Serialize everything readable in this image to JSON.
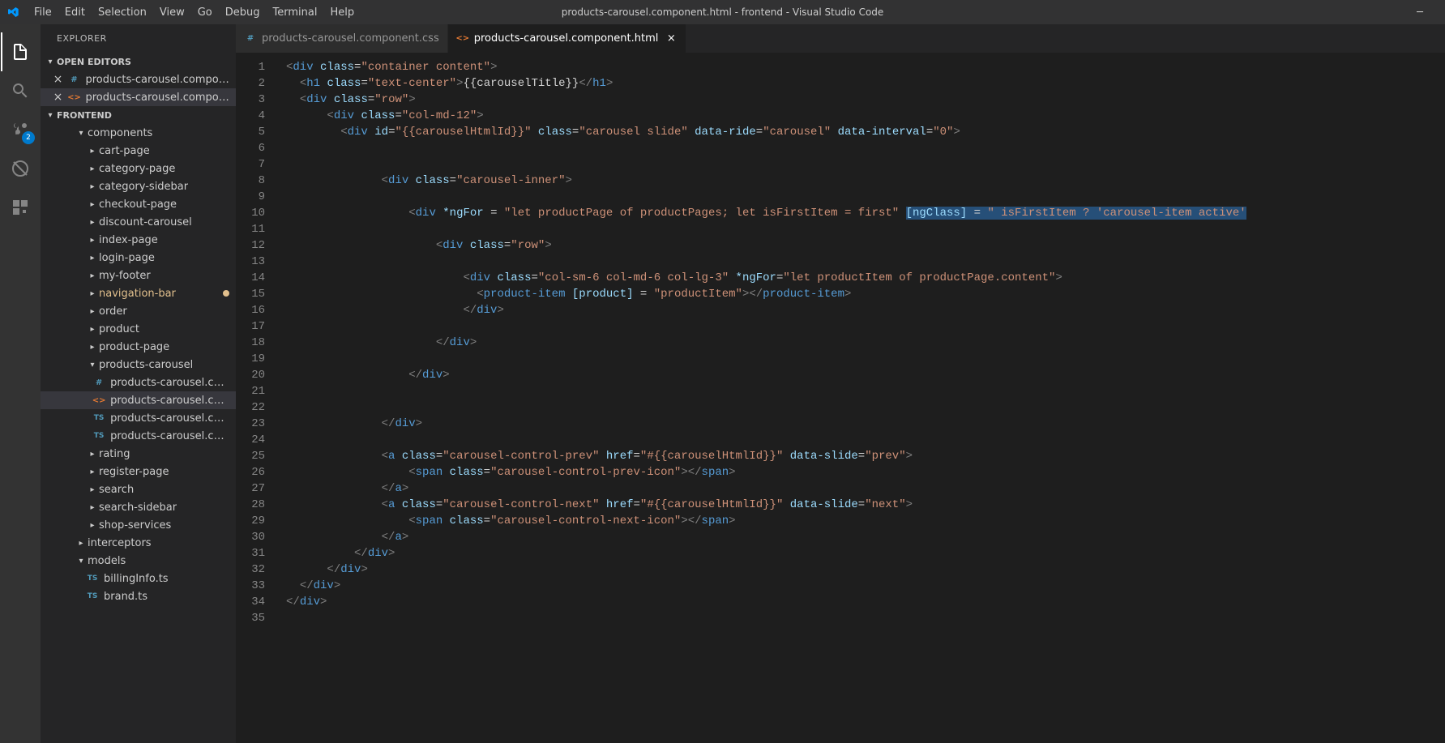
{
  "window": {
    "title": "products-carousel.component.html - frontend - Visual Studio Code"
  },
  "menu": [
    "File",
    "Edit",
    "Selection",
    "View",
    "Go",
    "Debug",
    "Terminal",
    "Help"
  ],
  "activity": {
    "badge_scm": "2"
  },
  "sidebar": {
    "title": "EXPLORER",
    "sections": {
      "openEditors": "OPEN EDITORS",
      "project": "FRONTEND"
    },
    "openEditors": [
      {
        "label": "products-carousel.compon...",
        "icon": "css"
      },
      {
        "label": "products-carousel.compon...",
        "icon": "html"
      }
    ],
    "tree": [
      {
        "d": 3,
        "type": "folder-open",
        "label": "components"
      },
      {
        "d": 4,
        "type": "folder",
        "label": "cart-page"
      },
      {
        "d": 4,
        "type": "folder",
        "label": "category-page"
      },
      {
        "d": 4,
        "type": "folder",
        "label": "category-sidebar"
      },
      {
        "d": 4,
        "type": "folder",
        "label": "checkout-page"
      },
      {
        "d": 4,
        "type": "folder",
        "label": "discount-carousel"
      },
      {
        "d": 4,
        "type": "folder",
        "label": "index-page"
      },
      {
        "d": 4,
        "type": "folder",
        "label": "login-page"
      },
      {
        "d": 4,
        "type": "folder",
        "label": "my-footer"
      },
      {
        "d": 4,
        "type": "folder",
        "label": "navigation-bar",
        "modified": true
      },
      {
        "d": 4,
        "type": "folder",
        "label": "order"
      },
      {
        "d": 4,
        "type": "folder",
        "label": "product"
      },
      {
        "d": 4,
        "type": "folder",
        "label": "product-page"
      },
      {
        "d": 4,
        "type": "folder-open",
        "label": "products-carousel"
      },
      {
        "d": 5,
        "type": "file",
        "icon": "css",
        "label": "products-carousel.com..."
      },
      {
        "d": 5,
        "type": "file",
        "icon": "html",
        "label": "products-carousel.com...",
        "active": true
      },
      {
        "d": 5,
        "type": "file",
        "icon": "ts",
        "label": "products-carousel.com..."
      },
      {
        "d": 5,
        "type": "file",
        "icon": "ts",
        "label": "products-carousel.com..."
      },
      {
        "d": 4,
        "type": "folder",
        "label": "rating"
      },
      {
        "d": 4,
        "type": "folder",
        "label": "register-page"
      },
      {
        "d": 4,
        "type": "folder",
        "label": "search"
      },
      {
        "d": 4,
        "type": "folder",
        "label": "search-sidebar"
      },
      {
        "d": 4,
        "type": "folder",
        "label": "shop-services"
      },
      {
        "d": 3,
        "type": "folder",
        "label": "interceptors"
      },
      {
        "d": 3,
        "type": "folder-open",
        "label": "models"
      },
      {
        "d": 4,
        "type": "file",
        "icon": "ts",
        "label": "billingInfo.ts"
      },
      {
        "d": 4,
        "type": "file",
        "icon": "ts",
        "label": "brand.ts"
      }
    ]
  },
  "tabs": [
    {
      "label": "products-carousel.component.css",
      "icon": "css",
      "active": false
    },
    {
      "label": "products-carousel.component.html",
      "icon": "html",
      "active": true
    }
  ],
  "editor": {
    "lineStart": 1,
    "lineEnd": 35,
    "code": [
      [
        [
          "br",
          "<"
        ],
        [
          "tag",
          "div"
        ],
        [
          "sp",
          " "
        ],
        [
          "attr",
          "class"
        ],
        [
          "eq",
          "="
        ],
        [
          "str",
          "\"container content\""
        ],
        [
          "br",
          ">"
        ]
      ],
      [
        [
          "sp",
          "  "
        ],
        [
          "br",
          "<"
        ],
        [
          "tag",
          "h1"
        ],
        [
          "sp",
          " "
        ],
        [
          "attr",
          "class"
        ],
        [
          "eq",
          "="
        ],
        [
          "str",
          "\"text-center\""
        ],
        [
          "br",
          ">"
        ],
        [
          "txt",
          "{{carouselTitle}}"
        ],
        [
          "br",
          "</"
        ],
        [
          "tag",
          "h1"
        ],
        [
          "br",
          ">"
        ]
      ],
      [
        [
          "sp",
          "  "
        ],
        [
          "br",
          "<"
        ],
        [
          "tag",
          "div"
        ],
        [
          "sp",
          " "
        ],
        [
          "attr",
          "class"
        ],
        [
          "eq",
          "="
        ],
        [
          "str",
          "\"row\""
        ],
        [
          "br",
          ">"
        ]
      ],
      [
        [
          "sp",
          "      "
        ],
        [
          "br",
          "<"
        ],
        [
          "tag",
          "div"
        ],
        [
          "sp",
          " "
        ],
        [
          "attr",
          "class"
        ],
        [
          "eq",
          "="
        ],
        [
          "str",
          "\"col-md-12\""
        ],
        [
          "br",
          ">"
        ]
      ],
      [
        [
          "sp",
          "        "
        ],
        [
          "br",
          "<"
        ],
        [
          "tag",
          "div"
        ],
        [
          "sp",
          " "
        ],
        [
          "attr",
          "id"
        ],
        [
          "eq",
          "="
        ],
        [
          "str",
          "\"{{carouselHtmlId}}\""
        ],
        [
          "sp",
          " "
        ],
        [
          "attr",
          "class"
        ],
        [
          "eq",
          "="
        ],
        [
          "str",
          "\"carousel slide\""
        ],
        [
          "sp",
          " "
        ],
        [
          "attr",
          "data-ride"
        ],
        [
          "eq",
          "="
        ],
        [
          "str",
          "\"carousel\""
        ],
        [
          "sp",
          " "
        ],
        [
          "attr",
          "data-interval"
        ],
        [
          "eq",
          "="
        ],
        [
          "str",
          "\"0\""
        ],
        [
          "br",
          ">"
        ]
      ],
      [
        [
          "sp",
          ""
        ]
      ],
      [
        [
          "sp",
          ""
        ]
      ],
      [
        [
          "sp",
          "              "
        ],
        [
          "br",
          "<"
        ],
        [
          "tag",
          "div"
        ],
        [
          "sp",
          " "
        ],
        [
          "attr",
          "class"
        ],
        [
          "eq",
          "="
        ],
        [
          "str",
          "\"carousel-inner\""
        ],
        [
          "br",
          ">"
        ]
      ],
      [
        [
          "sp",
          ""
        ]
      ],
      [
        [
          "sp",
          "                  "
        ],
        [
          "br",
          "<"
        ],
        [
          "tag",
          "div"
        ],
        [
          "sp",
          " "
        ],
        [
          "attr",
          "*ngFor"
        ],
        [
          "sp",
          " "
        ],
        [
          "eq",
          "="
        ],
        [
          "sp",
          " "
        ],
        [
          "str",
          "\"let productPage of productPages; let isFirstItem = first\""
        ],
        [
          "sp",
          " "
        ],
        [
          "hl-attr",
          "[ngClass]"
        ],
        [
          "hl-sp",
          " "
        ],
        [
          "hl-eq",
          "="
        ],
        [
          "hl-sp",
          " "
        ],
        [
          "hl-str",
          "\" isFirstItem ? 'carousel-item active'"
        ]
      ],
      [
        [
          "sp",
          ""
        ]
      ],
      [
        [
          "sp",
          "                      "
        ],
        [
          "br",
          "<"
        ],
        [
          "tag",
          "div"
        ],
        [
          "sp",
          " "
        ],
        [
          "attr",
          "class"
        ],
        [
          "eq",
          "="
        ],
        [
          "str",
          "\"row\""
        ],
        [
          "br",
          ">"
        ]
      ],
      [
        [
          "sp",
          ""
        ]
      ],
      [
        [
          "sp",
          "                          "
        ],
        [
          "br",
          "<"
        ],
        [
          "tag",
          "div"
        ],
        [
          "sp",
          " "
        ],
        [
          "attr",
          "class"
        ],
        [
          "eq",
          "="
        ],
        [
          "str",
          "\"col-sm-6 col-md-6 col-lg-3\""
        ],
        [
          "sp",
          " "
        ],
        [
          "attr",
          "*ngFor"
        ],
        [
          "eq",
          "="
        ],
        [
          "str",
          "\"let productItem of productPage.content\""
        ],
        [
          "br",
          ">"
        ]
      ],
      [
        [
          "sp",
          "                            "
        ],
        [
          "br",
          "<"
        ],
        [
          "tag",
          "product-item"
        ],
        [
          "sp",
          " "
        ],
        [
          "attr",
          "[product]"
        ],
        [
          "sp",
          " "
        ],
        [
          "eq",
          "="
        ],
        [
          "sp",
          " "
        ],
        [
          "str",
          "\"productItem\""
        ],
        [
          "br",
          ">"
        ],
        [
          "br",
          "</"
        ],
        [
          "tag",
          "product-item"
        ],
        [
          "br",
          ">"
        ]
      ],
      [
        [
          "sp",
          "                          "
        ],
        [
          "br",
          "</"
        ],
        [
          "tag",
          "div"
        ],
        [
          "br",
          ">"
        ]
      ],
      [
        [
          "sp",
          ""
        ]
      ],
      [
        [
          "sp",
          "                      "
        ],
        [
          "br",
          "</"
        ],
        [
          "tag",
          "div"
        ],
        [
          "br",
          ">"
        ]
      ],
      [
        [
          "sp",
          ""
        ]
      ],
      [
        [
          "sp",
          "                  "
        ],
        [
          "br",
          "</"
        ],
        [
          "tag",
          "div"
        ],
        [
          "br",
          ">"
        ]
      ],
      [
        [
          "sp",
          ""
        ]
      ],
      [
        [
          "sp",
          ""
        ]
      ],
      [
        [
          "sp",
          "              "
        ],
        [
          "br",
          "</"
        ],
        [
          "tag",
          "div"
        ],
        [
          "br",
          ">"
        ]
      ],
      [
        [
          "sp",
          ""
        ]
      ],
      [
        [
          "sp",
          "              "
        ],
        [
          "br",
          "<"
        ],
        [
          "tag",
          "a"
        ],
        [
          "sp",
          " "
        ],
        [
          "attr",
          "class"
        ],
        [
          "eq",
          "="
        ],
        [
          "str",
          "\"carousel-control-prev\""
        ],
        [
          "sp",
          " "
        ],
        [
          "attr",
          "href"
        ],
        [
          "eq",
          "="
        ],
        [
          "str",
          "\"#{{carouselHtmlId}}\""
        ],
        [
          "sp",
          " "
        ],
        [
          "attr",
          "data-slide"
        ],
        [
          "eq",
          "="
        ],
        [
          "str",
          "\"prev\""
        ],
        [
          "br",
          ">"
        ]
      ],
      [
        [
          "sp",
          "                  "
        ],
        [
          "br",
          "<"
        ],
        [
          "tag",
          "span"
        ],
        [
          "sp",
          " "
        ],
        [
          "attr",
          "class"
        ],
        [
          "eq",
          "="
        ],
        [
          "str",
          "\"carousel-control-prev-icon\""
        ],
        [
          "br",
          ">"
        ],
        [
          "br",
          "</"
        ],
        [
          "tag",
          "span"
        ],
        [
          "br",
          ">"
        ]
      ],
      [
        [
          "sp",
          "              "
        ],
        [
          "br",
          "</"
        ],
        [
          "tag",
          "a"
        ],
        [
          "br",
          ">"
        ]
      ],
      [
        [
          "sp",
          "              "
        ],
        [
          "br",
          "<"
        ],
        [
          "tag",
          "a"
        ],
        [
          "sp",
          " "
        ],
        [
          "attr",
          "class"
        ],
        [
          "eq",
          "="
        ],
        [
          "str",
          "\"carousel-control-next\""
        ],
        [
          "sp",
          " "
        ],
        [
          "attr",
          "href"
        ],
        [
          "eq",
          "="
        ],
        [
          "str",
          "\"#{{carouselHtmlId}}\""
        ],
        [
          "sp",
          " "
        ],
        [
          "attr",
          "data-slide"
        ],
        [
          "eq",
          "="
        ],
        [
          "str",
          "\"next\""
        ],
        [
          "br",
          ">"
        ]
      ],
      [
        [
          "sp",
          "                  "
        ],
        [
          "br",
          "<"
        ],
        [
          "tag",
          "span"
        ],
        [
          "sp",
          " "
        ],
        [
          "attr",
          "class"
        ],
        [
          "eq",
          "="
        ],
        [
          "str",
          "\"carousel-control-next-icon\""
        ],
        [
          "br",
          ">"
        ],
        [
          "br",
          "</"
        ],
        [
          "tag",
          "span"
        ],
        [
          "br",
          ">"
        ]
      ],
      [
        [
          "sp",
          "              "
        ],
        [
          "br",
          "</"
        ],
        [
          "tag",
          "a"
        ],
        [
          "br",
          ">"
        ]
      ],
      [
        [
          "sp",
          "          "
        ],
        [
          "br",
          "</"
        ],
        [
          "tag",
          "div"
        ],
        [
          "br",
          ">"
        ]
      ],
      [
        [
          "sp",
          "      "
        ],
        [
          "br",
          "</"
        ],
        [
          "tag",
          "div"
        ],
        [
          "br",
          ">"
        ]
      ],
      [
        [
          "sp",
          "  "
        ],
        [
          "br",
          "</"
        ],
        [
          "tag",
          "div"
        ],
        [
          "br",
          ">"
        ]
      ],
      [
        [
          "br",
          "</"
        ],
        [
          "tag",
          "div"
        ],
        [
          "br",
          ">"
        ]
      ],
      [
        [
          "sp",
          ""
        ]
      ]
    ]
  }
}
